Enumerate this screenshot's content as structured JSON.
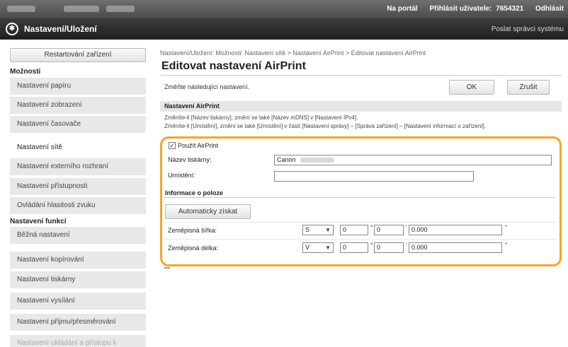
{
  "topbar": {
    "portal": "Na portál",
    "login": "Přihlásit uživatele:",
    "user_id": "7654321",
    "logout": "Odhlásit"
  },
  "header": {
    "title": "Nastavení/Uložení",
    "mail": "Poslat správci systému"
  },
  "sidebar": {
    "restart": "Restartování zařízení",
    "group1": "Možnosti",
    "items1": [
      "Nastavení papíru",
      "Nastavení zobrazení",
      "Nastavení časovače",
      "Nastavení sítě",
      "Nastavení externího rozhraní",
      "Nastavení přístupnosti",
      "Ovládání hlasitosti zvuku"
    ],
    "group2": "Nastavení funkcí",
    "items2": [
      "Běžná nastavení",
      "Nastavení kopírování",
      "Nastavení tiskárny",
      "Nastavení vysílání",
      "Nastavení příjmu/přesměrování",
      "Nastavení ukládání a přístupu k"
    ]
  },
  "main": {
    "breadcrumb": "Nastavení/Uložení: Možnosti: Nastavení sítě > Nastavení AirPrint > Editovat nastavení AirPrint",
    "title": "Editovat nastavení AirPrint",
    "instruction": "Změňte následující nastavení.",
    "ok": "OK",
    "cancel": "Zrušit",
    "section": "Nastavení AirPrint",
    "note1": "Změníte-li [Název tiskárny], změní se také [Název mDNS] v [Nastavení IPv4].",
    "note2": "Změníte-li [Umístění], změní se také [Umístění] v části [Nastavení správy] – [Správa zařízení] – [Nastavení informací o zařízení].",
    "use_airprint": "Použít AirPrint",
    "printer_name_label": "Název tiskárny:",
    "printer_name_value": "Canon",
    "location_label": "Umístění:",
    "location_value": "",
    "position_head": "Informace o poloze",
    "auto_button": "Automaticky získat",
    "lat_label": "Zeměpisná šířka:",
    "lat_dir": "S",
    "lat_deg": "0",
    "lat_min": "0",
    "lat_sec": "0.000",
    "lon_label": "Zeměpisná délka:",
    "lon_dir": "V",
    "lon_deg": "0",
    "lon_min": "0",
    "lon_sec": "0.000",
    "deg_sym": "°",
    "min_sym": "'",
    "sec_sym": "\""
  },
  "colors": {
    "highlight": "#f5a623",
    "header": "#2b2b2b",
    "sidebar": "#e8e8e8"
  },
  "icons": [
    "canon-logo-icon",
    "checkbox-checked-icon",
    "chevron-down-icon"
  ]
}
